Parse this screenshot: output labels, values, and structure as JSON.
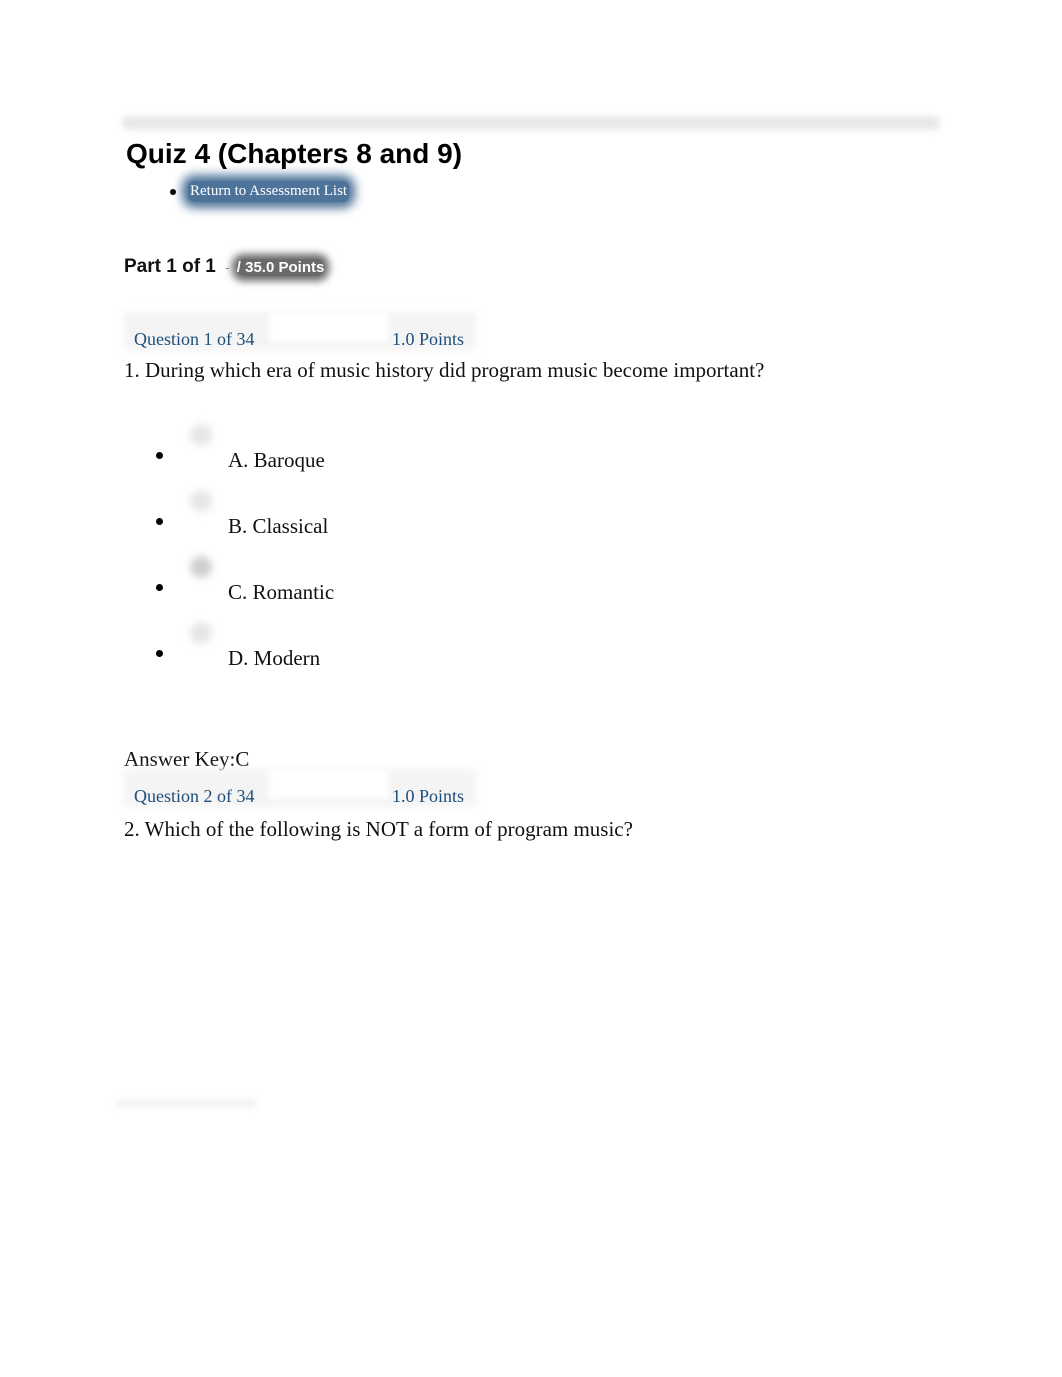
{
  "page": {
    "title": "Quiz 4 (Chapters 8 and 9)",
    "nav": [
      {
        "label": "Return to Assessment List"
      }
    ]
  },
  "part": {
    "label": "Part 1 of 1",
    "separator": "-",
    "points": "/ 35.0 Points"
  },
  "questions": [
    {
      "header": "Question 1 of 34",
      "points": "1.0 Points",
      "text": "1. During which era of music history did program music become important?",
      "options": [
        {
          "label": "A. Baroque",
          "selected": false
        },
        {
          "label": "B. Classical",
          "selected": false
        },
        {
          "label": "C. Romantic",
          "selected": true
        },
        {
          "label": "D. Modern",
          "selected": false
        }
      ],
      "answer_key": "Answer Key:C"
    },
    {
      "header": "Question 2 of 34",
      "points": "1.0 Points",
      "text": "2. Which of the following is NOT a form of program music?"
    }
  ]
}
